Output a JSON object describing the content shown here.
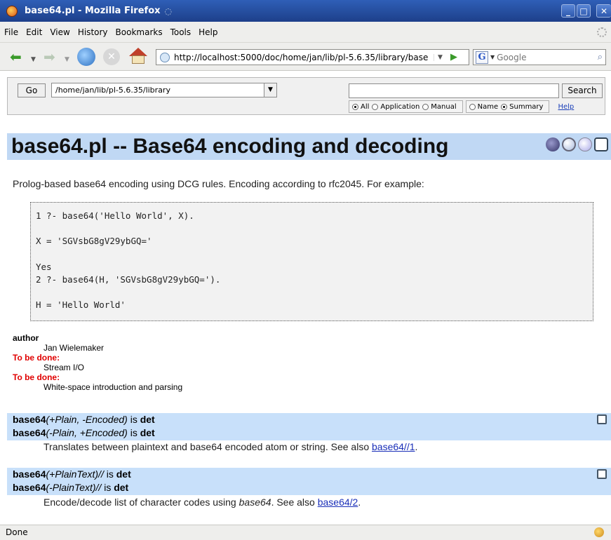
{
  "window": {
    "title": "base64.pl - Mozilla Firefox"
  },
  "menu": [
    "File",
    "Edit",
    "View",
    "History",
    "Bookmarks",
    "Tools",
    "Help"
  ],
  "nav": {
    "url": "http://localhost:5000/doc/home/jan/lib/pl-5.6.35/library/base",
    "search_placeholder": "Google"
  },
  "docform": {
    "go_label": "Go",
    "dir_value": "/home/jan/lib/pl-5.6.35/library",
    "query_value": "",
    "search_label": "Search",
    "scope_options": [
      {
        "label": "All",
        "selected": true
      },
      {
        "label": "Application",
        "selected": false
      },
      {
        "label": "Manual",
        "selected": false
      }
    ],
    "match_options": [
      {
        "label": "Name",
        "selected": false
      },
      {
        "label": "Summary",
        "selected": true
      }
    ],
    "help_label": "Help"
  },
  "page": {
    "title": "base64.pl -- Base64 encoding and decoding",
    "intro": "Prolog-based base64 encoding using DCG rules. Encoding according to rfc2045. For example:",
    "code": "1 ?- base64('Hello World', X).\n\nX = 'SGVsbG8gV29ybGQ='\n\nYes\n2 ?- base64(H, 'SGVsbG8gV29ybGQ=').\n\nH = 'Hello World'",
    "fields": [
      {
        "label": "author",
        "value": "Jan Wielemaker",
        "todo": false
      },
      {
        "label": "To be done:",
        "value": "Stream I/O",
        "todo": true
      },
      {
        "label": "To be done:",
        "value": "White-space introduction and parsing",
        "todo": true
      }
    ]
  },
  "predicates": [
    {
      "heads": [
        {
          "name": "base64",
          "args": "(+Plain, -Encoded)",
          "is": " is ",
          "det": "det"
        },
        {
          "name": "base64",
          "args": "(-Plain, +Encoded)",
          "is": " is ",
          "det": "det"
        }
      ],
      "desc_pre": "Translates between plaintext and base64 encoded atom or string. See also ",
      "desc_em": "",
      "desc_mid": "",
      "link": "base64//1",
      "desc_post": "."
    },
    {
      "heads": [
        {
          "name": "base64",
          "args": "(+PlainText)//",
          "is": " is ",
          "det": "det"
        },
        {
          "name": "base64",
          "args": "(-PlainText)//",
          "is": " is ",
          "det": "det"
        }
      ],
      "desc_pre": "Encode/decode list of character codes using ",
      "desc_em": "base64",
      "desc_mid": ". See also ",
      "link": "base64/2",
      "desc_post": "."
    }
  ],
  "status": {
    "text": "Done"
  }
}
